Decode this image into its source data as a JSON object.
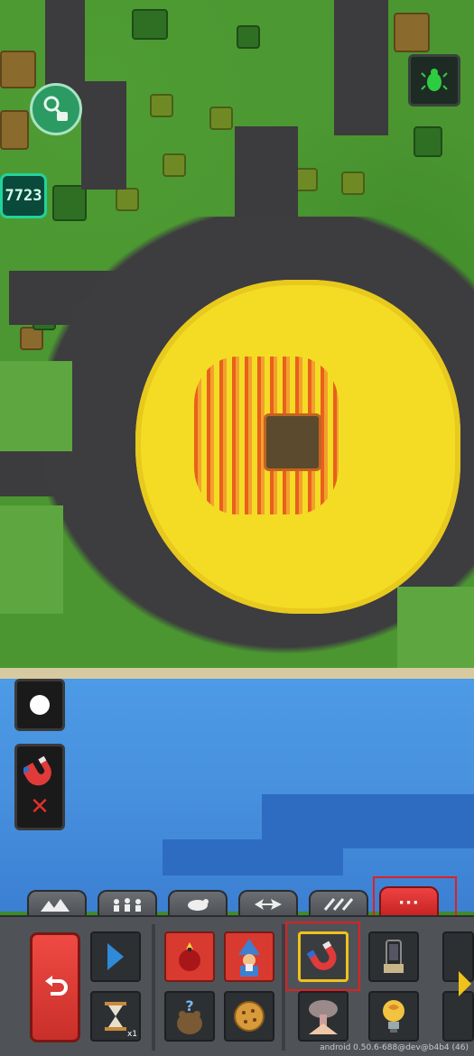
{
  "hud": {
    "unit_counter": "7723",
    "version_label": "android 0.50.6-688@dev@b4b4 (46)"
  },
  "overlay_icons": {
    "lock_button": "key-lock-icon",
    "bug_button": "beetle-icon",
    "brush": "brush-dot-icon",
    "active_power": "magnet-icon",
    "clear_power": "close-icon"
  },
  "tabs": [
    {
      "label": "",
      "icon": "mountains-icon"
    },
    {
      "label": "",
      "icon": "people-icon"
    },
    {
      "label": "",
      "icon": "animals-icon"
    },
    {
      "label": "",
      "icon": "nature-icon"
    },
    {
      "label": "",
      "icon": "tools-icon"
    },
    {
      "label": "···",
      "icon": "more-icon",
      "active": true
    }
  ],
  "toolbar": {
    "back_icon": "undo-arrow-icon",
    "play_icon": "play-icon",
    "speed_icon": "hourglass-icon",
    "speed_label": "x1",
    "powers": [
      {
        "icon": "fire-bomb-icon",
        "style": "red"
      },
      {
        "icon": "wizard-icon",
        "style": "red"
      },
      {
        "icon": "magnet-icon",
        "style": "selected"
      },
      {
        "icon": "phone-icon",
        "style": "normal"
      },
      {
        "icon": "mystery-creature-icon",
        "style": "normal"
      },
      {
        "icon": "cookie-icon",
        "style": "normal"
      },
      {
        "icon": "mushroom-cloud-icon",
        "style": "normal"
      },
      {
        "icon": "lightbulb-brain-icon",
        "style": "normal"
      }
    ]
  },
  "colors": {
    "grass": "#4b9631",
    "ash": "#3c3b3d",
    "lava": "#f4dc25",
    "water": "#4790de",
    "accent": "#e02020",
    "counter_border": "#21d39c"
  }
}
